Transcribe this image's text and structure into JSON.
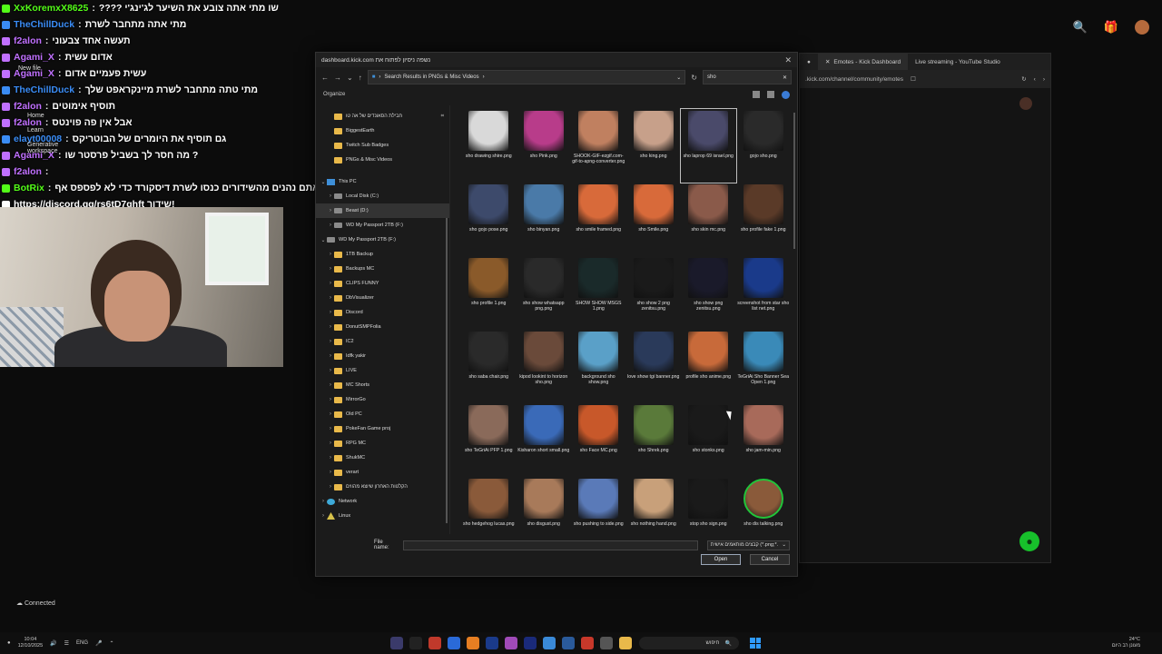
{
  "chat": [
    {
      "user": "XxKoremxX8625",
      "msg": "???? שו מתי אתה צובע את השיער לג'ינג'י",
      "color": "#53fc18"
    },
    {
      "user": "TheChillDuck",
      "msg": "מתי אתה מתחבר לשרת",
      "color": "#3a8cf5"
    },
    {
      "user": "f2alon",
      "msg": "תעשה אחד צבעוני",
      "color": "#c070ff"
    },
    {
      "user": "Agami_X",
      "msg": "אדום עשית",
      "color": "#c070ff"
    },
    {
      "user": "Agami_X",
      "msg": "עשית פעמיים אדום",
      "color": "#c070ff"
    },
    {
      "user": "TheChillDuck",
      "msg": "מתי טתה מתחבר לשרת מיינקראפט שלך",
      "color": "#3a8cf5"
    },
    {
      "user": "f2alon",
      "msg": "תוסיף אימוטים",
      "color": "#c070ff"
    },
    {
      "user": "f2alon",
      "msg": "אבל אין פה פוינטס",
      "color": "#c070ff"
    },
    {
      "user": "elayt00008",
      "msg": "גם תוסיף את היומרים של הבוטריקס",
      "color": "#3a8cf5"
    },
    {
      "user": "Agami_X",
      "msg": "מה חסר לך בשביל פרסטר שו ?",
      "color": "#c070ff"
    },
    {
      "user": "f2alon",
      "msg": "",
      "color": "#c070ff"
    },
    {
      "user": "BotRix",
      "msg": "אם אתם נהנים מהשידורים כנסו לשרת דיסקורד כדי לא לפספס אף",
      "color": "#53fc18"
    },
    {
      "user": "",
      "msg": "https://discord.gg/rs6tD7ghft שידור!",
      "color": "#ffffff"
    }
  ],
  "desktop_icons": [
    "New file",
    "Home",
    "Learn",
    "Generative workspace"
  ],
  "status": {
    "connected": "Connected"
  },
  "browser": {
    "tabs": [
      "Emotes - Kick Dashboard",
      "Live streaming - YouTube Studio"
    ],
    "address": ".kick.com/channel/community/emotes"
  },
  "dialog": {
    "title": "dashboard.kick.com נשפה ניסיון לפתוח את",
    "path": "Search Results in PNGs & Misc Videos",
    "search": "sho",
    "organize": "Organize",
    "sidebar": [
      {
        "label": "חבילת הסאונדים של אה טו",
        "type": "folder",
        "level": 1,
        "pin": true
      },
      {
        "label": "BiggestEarth",
        "type": "folder",
        "level": 1
      },
      {
        "label": "Twitch Sub Badges",
        "type": "folder",
        "level": 1
      },
      {
        "label": "PNGs & Misc Videos",
        "type": "folder",
        "level": 1
      },
      {
        "label": "",
        "type": "spacer",
        "level": 0
      },
      {
        "label": "This PC",
        "type": "pc",
        "level": 0,
        "open": true
      },
      {
        "label": "Local Disk (C:)",
        "type": "drive",
        "level": 1
      },
      {
        "label": "Beast (D:)",
        "type": "drive",
        "level": 1,
        "selected": true
      },
      {
        "label": "WD My Passport 2TB (F:)",
        "type": "drive",
        "level": 1
      },
      {
        "label": "WD My Passport 2TB (F:)",
        "type": "drive",
        "level": 0,
        "open": true
      },
      {
        "label": "1TB Backup",
        "type": "folder",
        "level": 1
      },
      {
        "label": "Backups MC",
        "type": "folder",
        "level": 1
      },
      {
        "label": "CLIPS FUNNY",
        "type": "folder",
        "level": 1
      },
      {
        "label": "DbVisualizer",
        "type": "folder",
        "level": 1
      },
      {
        "label": "Discord",
        "type": "folder",
        "level": 1
      },
      {
        "label": "DonutSMPFolia",
        "type": "folder",
        "level": 1
      },
      {
        "label": "IC2",
        "type": "folder",
        "level": 1
      },
      {
        "label": "Idfk yakir",
        "type": "folder",
        "level": 1
      },
      {
        "label": "LIVE",
        "type": "folder",
        "level": 1
      },
      {
        "label": "MC Shorts",
        "type": "folder",
        "level": 1
      },
      {
        "label": "MirrorGo",
        "type": "folder",
        "level": 1
      },
      {
        "label": "Old PC",
        "type": "folder",
        "level": 1
      },
      {
        "label": "PokeFan Game proj",
        "type": "folder",
        "level": 1
      },
      {
        "label": "RPG MC",
        "type": "folder",
        "level": 1
      },
      {
        "label": "ShukMC",
        "type": "folder",
        "level": 1
      },
      {
        "label": "verart",
        "type": "folder",
        "level": 1
      },
      {
        "label": "הקלטות האחרון שיוצא מהווים",
        "type": "folder",
        "level": 1
      },
      {
        "label": "Network",
        "type": "net",
        "level": 0
      },
      {
        "label": "Linux",
        "type": "linux",
        "level": 0
      }
    ],
    "files": [
      {
        "name": "sho drawing shire.png",
        "color": "#d9d9d9"
      },
      {
        "name": "sho Pink.png",
        "color": "#b83c8a"
      },
      {
        "name": "SHOOK-GIF-ezgif.com-gif-to-apng-converter.png",
        "color": "#c08060"
      },
      {
        "name": "sho king.png",
        "color": "#c7a08a"
      },
      {
        "name": "sho laprop 69 israel.png",
        "color": "#4a4a6a",
        "selected": true
      },
      {
        "name": "gojo sho.png",
        "color": "#2a2a2a"
      },
      {
        "name": "sho gojo pose.png",
        "color": "#3d4a6b"
      },
      {
        "name": "sho binyan.png",
        "color": "#4a7aa8"
      },
      {
        "name": "sho smile framed.png",
        "color": "#d86a3a"
      },
      {
        "name": "sho Smile.png",
        "color": "#d86a3a"
      },
      {
        "name": "sho skin mc.png",
        "color": "#8a5a4a"
      },
      {
        "name": "sho profile fake 1.png",
        "color": "#5a3a28"
      },
      {
        "name": "sho profile 1.png",
        "color": "#8a5a2a"
      },
      {
        "name": "sho show whatsapp png.png",
        "color": "#2a2a2a"
      },
      {
        "name": "SHOW SHOW MSGS 1.png",
        "color": "#1a2a2a"
      },
      {
        "name": "sho show 2 png zenitsu.png",
        "color": "#1a1a1a"
      },
      {
        "name": "sho show png zenitsu.png",
        "color": "#1a1a2a"
      },
      {
        "name": "screenshot from star sho list net.png",
        "color": "#1a3a8a"
      },
      {
        "name": "sho saba chair.png",
        "color": "#2a2a2a"
      },
      {
        "name": "kipod lookint to horizon sho.png",
        "color": "#6a4a3a"
      },
      {
        "name": "background sho show.png",
        "color": "#5aa0c8"
      },
      {
        "name": "love show tgi banner.png",
        "color": "#2a3a5a"
      },
      {
        "name": "profile sho anime.png",
        "color": "#c86a3a"
      },
      {
        "name": "TeGriAi Sho Banner Sea Open 1.png",
        "color": "#3a8ab8"
      },
      {
        "name": "sho TeGriAi PFP 1.png",
        "color": "#8a6a5a"
      },
      {
        "name": "Kisharon short small.png",
        "color": "#3a6ab8"
      },
      {
        "name": "sho Face MC.png",
        "color": "#c8582a"
      },
      {
        "name": "sho Shrek.png",
        "color": "#5a7a3a"
      },
      {
        "name": "sho stonks.png",
        "color": "#1a1a1a"
      },
      {
        "name": "sho jam-min.png",
        "color": "#a86a5a"
      },
      {
        "name": "sho hedgehog lucas.png",
        "color": "#8a5a3a"
      },
      {
        "name": "sho disgust.png",
        "color": "#a87a5a"
      },
      {
        "name": "sho pushing to side.png",
        "color": "#5a7ab8"
      },
      {
        "name": "sho nothing hand.png",
        "color": "#c8a07a"
      },
      {
        "name": "stop sho sign.png",
        "color": "#1a1a1a"
      },
      {
        "name": "sho dis talking.png",
        "color": "#8a5a3a",
        "ring": "#21c43a"
      }
    ],
    "filename_label": "File name:",
    "filename_value": "",
    "filetype": "קבצים מותאמים אישית (*.png;*.",
    "open_label": "Open",
    "cancel_label": "Cancel"
  },
  "taskbar": {
    "time": "10:04",
    "date": "12/10/2025",
    "lang": "ENG",
    "search_text": "חיפוש",
    "weather_temp": "24°C",
    "weather_desc": "מעונן רב היום"
  }
}
